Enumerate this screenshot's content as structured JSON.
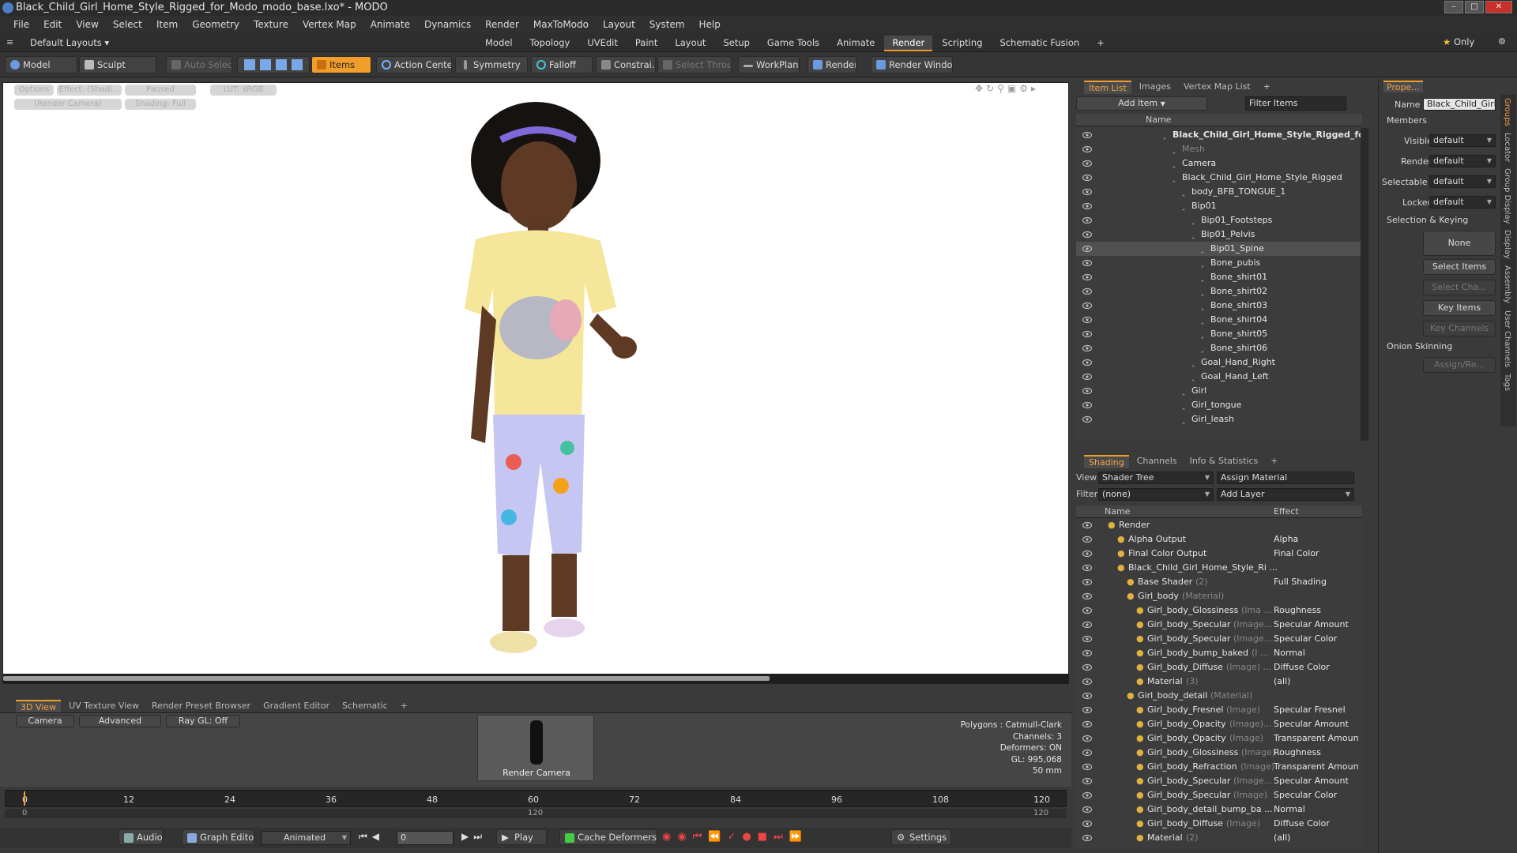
{
  "window": {
    "title": "Black_Child_Girl_Home_Style_Rigged_for_Modo_modo_base.lxo* - MODO"
  },
  "menu": [
    "File",
    "Edit",
    "View",
    "Select",
    "Item",
    "Geometry",
    "Texture",
    "Vertex Map",
    "Animate",
    "Dynamics",
    "Render",
    "MaxToModo",
    "Layout",
    "System",
    "Help"
  ],
  "layout": {
    "default_layouts": "Default Layouts",
    "tabs": [
      "Model",
      "Topology",
      "UVEdit",
      "Paint",
      "Layout",
      "Setup",
      "Game Tools",
      "Animate",
      "Render",
      "Scripting",
      "Schematic Fusion"
    ],
    "active_tab": "Render",
    "only": "Only"
  },
  "toolbar": {
    "model": "Model",
    "sculpt": "Sculpt",
    "auto_select": "Auto Select",
    "items": "Items",
    "action_center": "Action Center",
    "symmetry": "Symmetry",
    "falloff": "Falloff",
    "constrain": "Constrai...",
    "select_through": "Select Through",
    "workplane": "WorkPlane",
    "render": "Render",
    "render_window": "Render Window"
  },
  "viewport": {
    "options": "Options",
    "effect": "Effect: (Shadi...",
    "paused": "Paused",
    "lut": "LUT: sRGB",
    "render_camera": "(Render Camera)",
    "shading": "Shading: Full"
  },
  "bottom_tabs": [
    "3D View",
    "UV Texture View",
    "Render Preset Browser",
    "Gradient Editor",
    "Schematic"
  ],
  "bottom_view": {
    "camera": "Camera",
    "advanced": "Advanced",
    "raygl": "Ray GL: Off",
    "thumb_label": "Render Camera",
    "stats": [
      "Polygons : Catmull-Clark",
      "Channels: 3",
      "Deformers: ON",
      "GL: 995,068",
      "50 mm"
    ]
  },
  "timeline": {
    "ticks": [
      "0",
      "12",
      "24",
      "36",
      "48",
      "60",
      "72",
      "84",
      "96",
      "108",
      "120"
    ],
    "lower": [
      "0",
      "120",
      "120"
    ]
  },
  "transport": {
    "audio": "Audio",
    "graph_editor": "Graph Editor",
    "animated": "Animated",
    "frame": "0",
    "play": "Play",
    "cache_deformers": "Cache Deformers",
    "settings": "Settings"
  },
  "item_list": {
    "tabs": [
      "Item List",
      "Images",
      "Vertex Map List"
    ],
    "add_item": "Add Item",
    "filter_items": "Filter Items",
    "name_header": "Name",
    "rows": [
      {
        "label": "Black_Child_Girl_Home_Style_Rigged_fo...",
        "indent": 0,
        "bold": true
      },
      {
        "label": "Mesh",
        "indent": 1,
        "dim": true
      },
      {
        "label": "Camera",
        "indent": 1
      },
      {
        "label": "Black_Child_Girl_Home_Style_Rigged",
        "indent": 1
      },
      {
        "label": "body_BFB_TONGUE_1",
        "indent": 2
      },
      {
        "label": "Bip01",
        "indent": 2
      },
      {
        "label": "Bip01_Footsteps",
        "indent": 3
      },
      {
        "label": "Bip01_Pelvis",
        "indent": 3
      },
      {
        "label": "Bip01_Spine",
        "indent": 4,
        "selected": true
      },
      {
        "label": "Bone_pubis",
        "indent": 4
      },
      {
        "label": "Bone_shirt01",
        "indent": 4
      },
      {
        "label": "Bone_shirt02",
        "indent": 4
      },
      {
        "label": "Bone_shirt03",
        "indent": 4
      },
      {
        "label": "Bone_shirt04",
        "indent": 4
      },
      {
        "label": "Bone_shirt05",
        "indent": 4
      },
      {
        "label": "Bone_shirt06",
        "indent": 4
      },
      {
        "label": "Goal_Hand_Right",
        "indent": 3
      },
      {
        "label": "Goal_Hand_Left",
        "indent": 3
      },
      {
        "label": "Girl",
        "indent": 2
      },
      {
        "label": "Girl_tongue",
        "indent": 2
      },
      {
        "label": "Girl_leash",
        "indent": 2
      }
    ]
  },
  "shading": {
    "tabs": [
      "Shading",
      "Channels",
      "Info & Statistics"
    ],
    "view_label": "View",
    "view_value": "Shader Tree",
    "assign_material": "Assign Material",
    "filter_label": "Filter",
    "filter_value": "(none)",
    "add_layer": "Add Layer",
    "name_header": "Name",
    "effect_header": "Effect",
    "rows": [
      {
        "label": "Render",
        "sub": "",
        "effect": "",
        "indent": 0
      },
      {
        "label": "Alpha Output",
        "sub": "",
        "effect": "Alpha",
        "indent": 1
      },
      {
        "label": "Final Color Output",
        "sub": "",
        "effect": "Final Color",
        "indent": 1
      },
      {
        "label": "Black_Child_Girl_Home_Style_Ri ...",
        "sub": "",
        "effect": "",
        "indent": 1
      },
      {
        "label": "Base Shader",
        "sub": "(2)",
        "effect": "Full Shading",
        "indent": 2
      },
      {
        "label": "Girl_body",
        "sub": "(Material)",
        "effect": "",
        "indent": 2
      },
      {
        "label": "Girl_body_Glossiness",
        "sub": "(Ima ...",
        "effect": "Roughness",
        "indent": 3
      },
      {
        "label": "Girl_body_Specular",
        "sub": "(Image...",
        "effect": "Specular Amount",
        "indent": 3
      },
      {
        "label": "Girl_body_Specular",
        "sub": "(Image...",
        "effect": "Specular Color",
        "indent": 3
      },
      {
        "label": "Girl_body_bump_baked",
        "sub": "(I ...",
        "effect": "Normal",
        "indent": 3
      },
      {
        "label": "Girl_body_Diffuse",
        "sub": "(Image) ...",
        "effect": "Diffuse Color",
        "indent": 3
      },
      {
        "label": "Material",
        "sub": "(3)",
        "effect": "(all)",
        "indent": 3
      },
      {
        "label": "Girl_body_detail",
        "sub": "(Material)",
        "effect": "",
        "indent": 2
      },
      {
        "label": "Girl_body_Fresnel",
        "sub": "(Image)",
        "effect": "Specular Fresnel",
        "indent": 3
      },
      {
        "label": "Girl_body_Opacity",
        "sub": "(Image)...",
        "effect": "Specular Amount",
        "indent": 3
      },
      {
        "label": "Girl_body_Opacity",
        "sub": "(Image)",
        "effect": "Transparent Amount",
        "indent": 3
      },
      {
        "label": "Girl_body_Glossiness",
        "sub": "(Image)",
        "effect": "Roughness",
        "indent": 3
      },
      {
        "label": "Girl_body_Refraction",
        "sub": "(Image)",
        "effect": "Transparent Amount",
        "indent": 3
      },
      {
        "label": "Girl_body_Specular",
        "sub": "(Image...",
        "effect": "Specular Amount",
        "indent": 3
      },
      {
        "label": "Girl_body_Specular",
        "sub": "(Image)",
        "effect": "Specular Color",
        "indent": 3
      },
      {
        "label": "Girl_body_detail_bump_ba ...",
        "sub": "",
        "effect": "Normal",
        "indent": 3
      },
      {
        "label": "Girl_body_Diffuse",
        "sub": "(Image)",
        "effect": "Diffuse Color",
        "indent": 3
      },
      {
        "label": "Material",
        "sub": "(2)",
        "effect": "(all)",
        "indent": 3
      }
    ]
  },
  "properties": {
    "tab": "Prope...",
    "name_label": "Name",
    "name_value": "Black_Child_Girl...",
    "members": "Members",
    "visible_label": "Visible",
    "visible_value": "default",
    "render_label": "Render",
    "render_value": "default",
    "selectable_label": "Selectable",
    "selectable_value": "default",
    "locked_label": "Locked",
    "locked_value": "default",
    "selection_keying": "Selection & Keying",
    "none": "None",
    "select_items": "Select Items",
    "select_cha": "Select Cha...",
    "key_items": "Key Items",
    "key_channels": "Key Channels",
    "onion_skinning": "Onion Skinning",
    "assign_re": "Assign/Re...",
    "side_tabs": [
      "Groups",
      "Locator",
      "Group Display",
      "Display",
      "Assembly",
      "User Channels",
      "Tags"
    ]
  },
  "colors": {
    "accent": "#f29e2b",
    "selected_row": "#505050"
  }
}
